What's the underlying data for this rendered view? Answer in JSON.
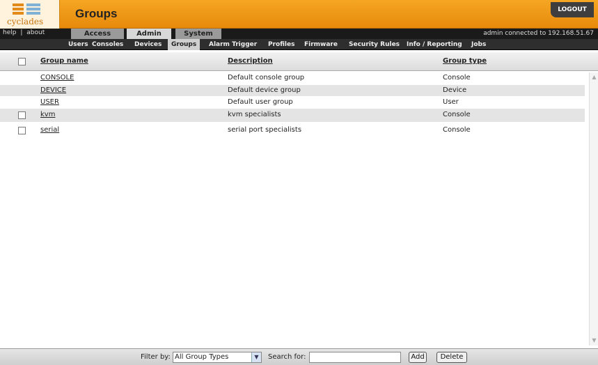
{
  "header": {
    "logo_text": "cyclades",
    "page_title": "Groups",
    "logout_label": "LOGOUT"
  },
  "top_links": {
    "help": "help",
    "separator": "|",
    "about": "about"
  },
  "tabs": [
    {
      "label": "Access",
      "active": false
    },
    {
      "label": "Admin",
      "active": true
    },
    {
      "label": "System",
      "active": false
    }
  ],
  "connection_status": "admin connected to 192.168.51.67",
  "subnav": [
    {
      "label": "Users",
      "active": false
    },
    {
      "label": "Consoles",
      "active": false
    },
    {
      "label": "Devices",
      "active": false
    },
    {
      "label": "Groups",
      "active": true
    },
    {
      "label": "Alarm Trigger",
      "active": false
    },
    {
      "label": "Profiles",
      "active": false
    },
    {
      "label": "Firmware",
      "active": false
    },
    {
      "label": "Security Rules",
      "active": false
    },
    {
      "label": "Info / Reporting",
      "active": false
    },
    {
      "label": "Jobs",
      "active": false
    }
  ],
  "table": {
    "columns": [
      "Group name",
      "Description",
      "Group type"
    ],
    "rows": [
      {
        "name": "CONSOLE",
        "description": "Default console group",
        "type": "Console",
        "checkbox": false
      },
      {
        "name": "DEVICE",
        "description": "Default device group",
        "type": "Device",
        "checkbox": false
      },
      {
        "name": "USER",
        "description": "Default user group",
        "type": "User",
        "checkbox": false
      },
      {
        "name": "kvm",
        "description": "kvm specialists",
        "type": "Console",
        "checkbox": true
      },
      {
        "name": "serial",
        "description": "serial port specialists",
        "type": "Console",
        "checkbox": true
      }
    ]
  },
  "footer": {
    "filter_label": "Filter by:",
    "filter_value": "All Group Types",
    "search_label": "Search for:",
    "search_value": "",
    "add_label": "Add",
    "delete_label": "Delete"
  }
}
